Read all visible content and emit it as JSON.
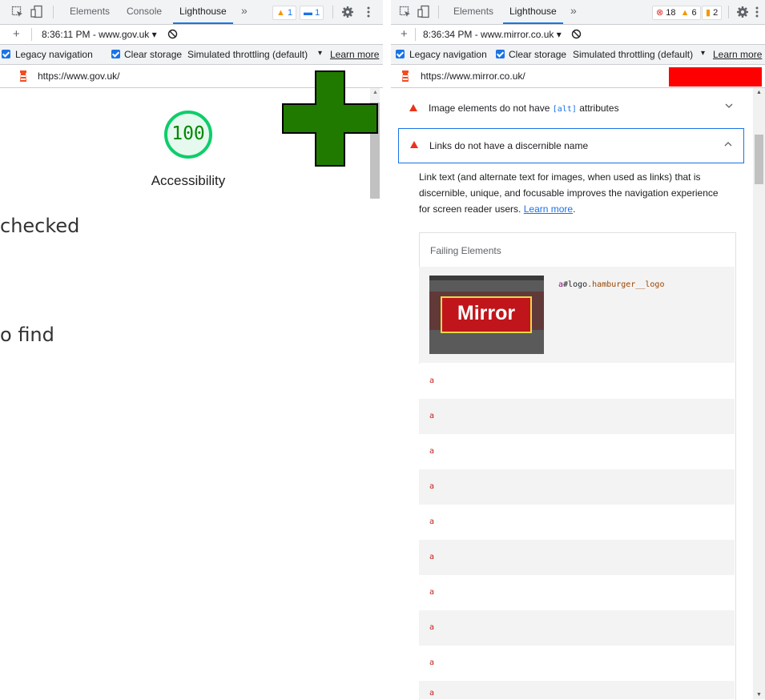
{
  "left_panel": {
    "tabs": [
      "Elements",
      "Console",
      "Lighthouse"
    ],
    "more_tabs": "»",
    "warn_badge": "1",
    "info_badge": "1",
    "add_label": "+",
    "report_select": "8:36:11 PM - www.gov.uk ▾",
    "options": {
      "legacy_navigation": "Legacy navigation",
      "clear_storage": "Clear storage",
      "throttling": "Simulated throttling (default)",
      "learn_more": "Learn more",
      "learn_more_arrow": "▾"
    },
    "url": "https://www.gov.uk/",
    "score": "100",
    "category": "Accessibility"
  },
  "background_text": {
    "line1": "checked",
    "line2": "o find"
  },
  "right_panel": {
    "tabs": [
      "Elements",
      "Lighthouse"
    ],
    "more_tabs": "»",
    "error_badge": "18",
    "warn_badge": "6",
    "issues_badge": "2",
    "add_label": "+",
    "report_select": "8:36:34 PM - www.mirror.co.uk ▾",
    "options": {
      "legacy_navigation": "Legacy navigation",
      "clear_storage": "Clear storage",
      "throttling": "Simulated throttling (default)",
      "learn_more": "Learn more",
      "learn_more_arrow": "▾"
    },
    "url": "https://www.mirror.co.uk/",
    "audit1": {
      "prefix": "Image elements do not have ",
      "code": "[alt]",
      "suffix": " attributes"
    },
    "audit2": {
      "title": "Links do not have a discernible name",
      "description": "Link text (and alternate text for images, when used as links) that is discernible, unique, and focusable improves the navigation experience for screen reader users.",
      "learn_more": "Learn more",
      "period": "."
    },
    "failing_header": "Failing Elements",
    "first_selector": {
      "tag": "a",
      "id": "#logo",
      "class": ".hamburger__logo"
    },
    "logo_text": "Mirror",
    "failing_rows": [
      "a",
      "a",
      "a",
      "a",
      "a",
      "a",
      "a",
      "a",
      "a",
      "a"
    ]
  },
  "colors": {
    "accent": "#1a73e8",
    "score_green": "#0cce6b",
    "score_text": "#008800",
    "fail_red": "#e8341a",
    "plus_green": "#217a00",
    "redact_red": "#ff0000",
    "mirror_red": "#c0151b"
  }
}
